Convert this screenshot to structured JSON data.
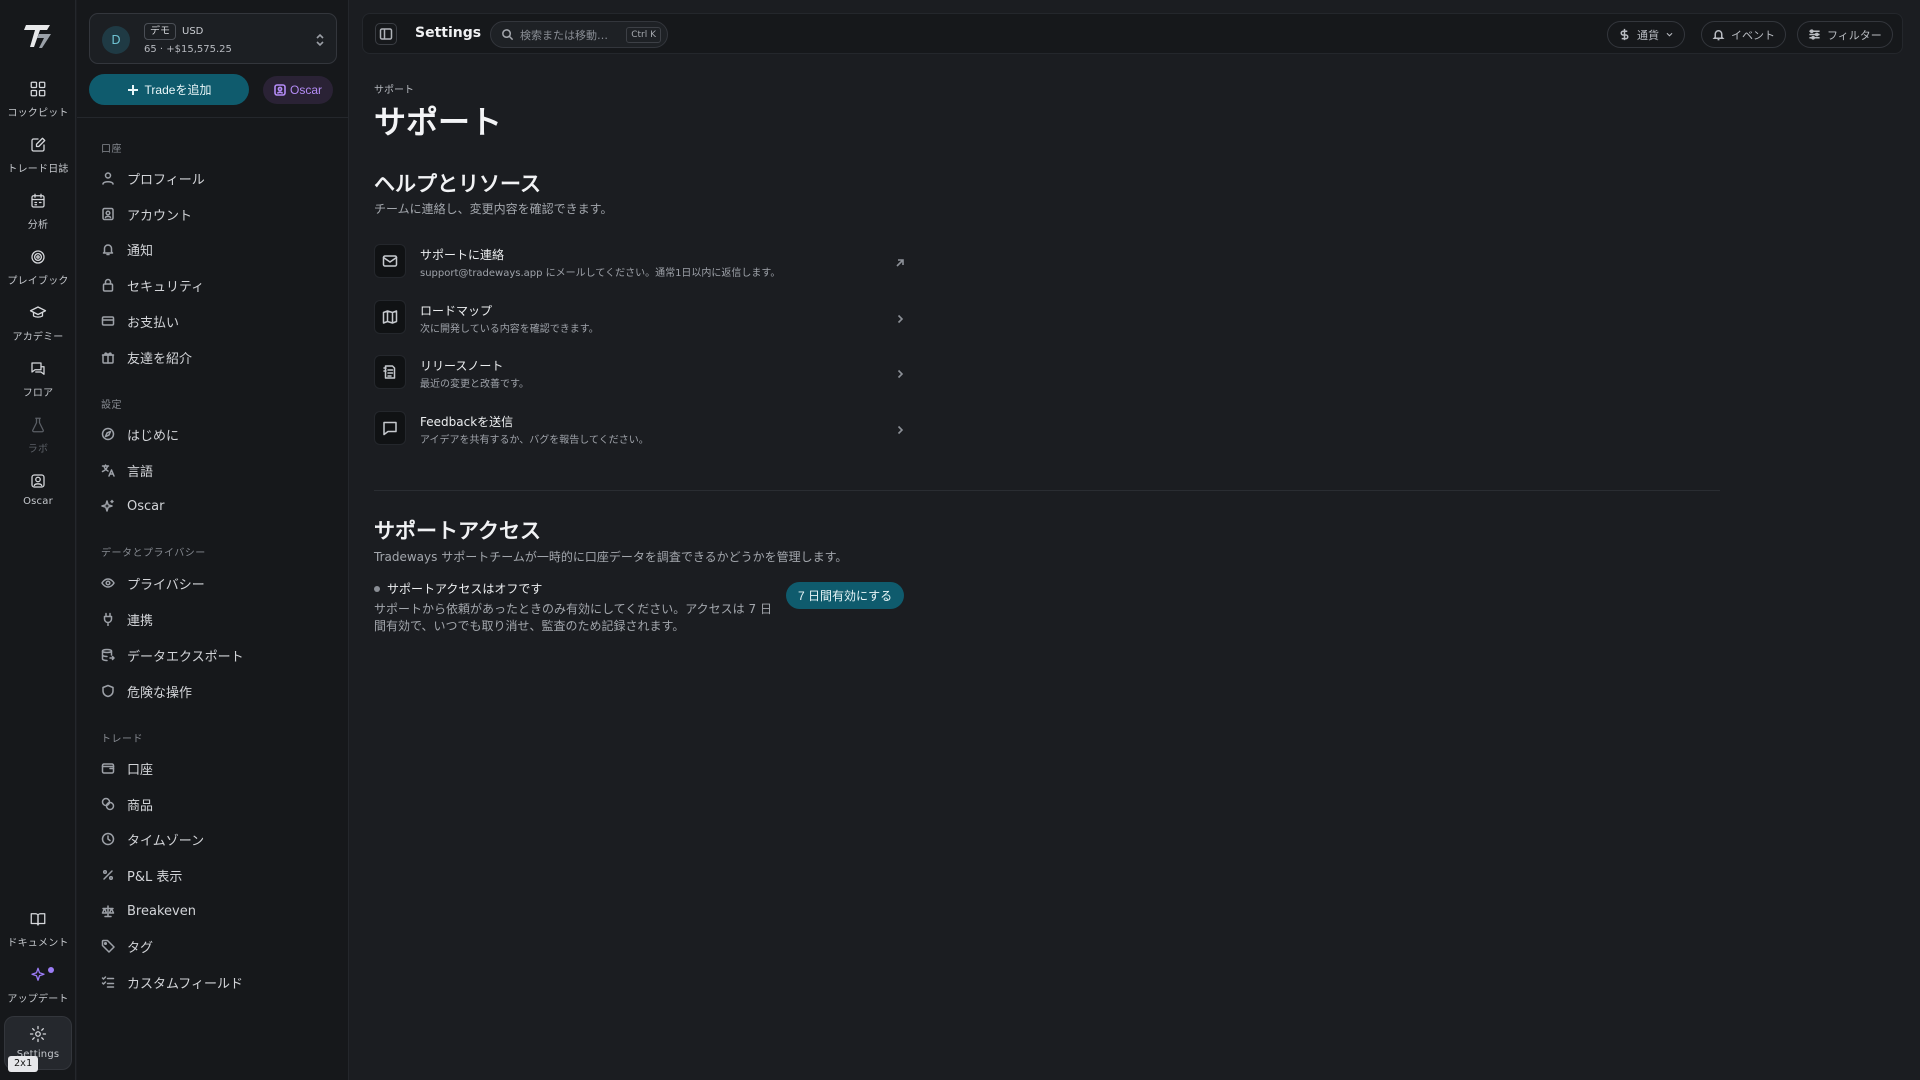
{
  "rail": {
    "items": [
      {
        "label": "コックピット",
        "icon": "dashboard-icon"
      },
      {
        "label": "トレード日誌",
        "icon": "journal-icon"
      },
      {
        "label": "分析",
        "icon": "calendar-icon"
      },
      {
        "label": "プレイブック",
        "icon": "target-icon"
      },
      {
        "label": "アカデミー",
        "icon": "graduation-cap-icon"
      },
      {
        "label": "フロア",
        "icon": "chat-icon"
      },
      {
        "label": "ラボ",
        "icon": "flask-icon"
      },
      {
        "label": "Oscar",
        "icon": "oscar-icon"
      }
    ],
    "bottom": [
      {
        "label": "ドキュメント",
        "icon": "book-icon"
      },
      {
        "label": "アップデート",
        "icon": "sparkle-icon"
      },
      {
        "label": "Settings",
        "icon": "gear-icon"
      }
    ],
    "badge": "2x1"
  },
  "account": {
    "avatar": "D",
    "tag": "デモ",
    "currency": "USD",
    "balance": "65 · +$15,575.25"
  },
  "actions": {
    "add_trade": "Tradeを追加",
    "oscar": "Oscar"
  },
  "sidebar": {
    "sections": [
      {
        "heading": "口座",
        "items": [
          "プロフィール",
          "アカウント",
          "通知",
          "セキュリティ",
          "お支払い",
          "友達を紹介"
        ]
      },
      {
        "heading": "設定",
        "items": [
          "はじめに",
          "言語",
          "Oscar"
        ]
      },
      {
        "heading": "データとプライバシー",
        "items": [
          "プライバシー",
          "連携",
          "データエクスポート",
          "危険な操作"
        ]
      },
      {
        "heading": "トレード",
        "items": [
          "口座",
          "商品",
          "タイムゾーン",
          "P&L 表示",
          "Breakeven",
          "タグ",
          "カスタムフィールド"
        ]
      }
    ]
  },
  "topbar": {
    "title": "Settings",
    "search_placeholder": "検索または移動…",
    "search_shortcut": "Ctrl K",
    "currency": "通貨",
    "events": "イベント",
    "filter": "フィルター"
  },
  "page": {
    "breadcrumb": "サポート",
    "title": "サポート",
    "help": {
      "heading": "ヘルプとリソース",
      "subtitle": "チームに連絡し、変更内容を確認できます。",
      "rows": [
        {
          "title": "サポートに連絡",
          "desc": "support@tradeways.app にメールしてください。通常1日以内に返信します。",
          "icon": "mail-icon"
        },
        {
          "title": "ロードマップ",
          "desc": "次に開発している内容を確認できます。",
          "icon": "map-icon"
        },
        {
          "title": "リリースノート",
          "desc": "最近の変更と改善です。",
          "icon": "notes-icon"
        },
        {
          "title": "Feedbackを送信",
          "desc": "アイデアを共有するか、バグを報告してください。",
          "icon": "message-icon"
        }
      ]
    },
    "access": {
      "heading": "サポートアクセス",
      "subtitle": "Tradeways サポートチームが一時的に口座データを調査できるかどうかを管理します。",
      "status": "サポートアクセスはオフです",
      "desc": "サポートから依頼があったときのみ有効にしてください。アクセスは 7 日間有効で、いつでも取り消せ、監査のため記録されます。",
      "button": "7 日間有効にする"
    }
  },
  "colors": {
    "accent": "#0f5b6d",
    "oscar": "#b48cf6",
    "background": "#1b1d21",
    "sidebar": "#16181b"
  }
}
